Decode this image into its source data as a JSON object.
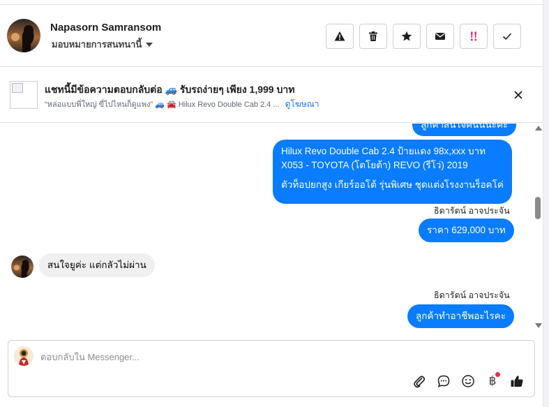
{
  "header": {
    "name": "Napasorn Samransom",
    "assign_label": "มอบหมายการสนทนานี้",
    "actions": [
      {
        "name": "spam-button",
        "icon": "warning-icon"
      },
      {
        "name": "delete-button",
        "icon": "trash-icon"
      },
      {
        "name": "star-button",
        "icon": "star-icon"
      },
      {
        "name": "mark-unread-button",
        "icon": "envelope-icon"
      },
      {
        "name": "follow-up-button",
        "icon": "double-exclamation-icon"
      },
      {
        "name": "done-button",
        "icon": "check-icon"
      }
    ]
  },
  "ad": {
    "title": "แชทนี้มีข้อความตอบกลับต่อ 🚙 รับรถง่ายๆ เพียง 1,999 บาท",
    "subtitle": "“หล่อแบบพี่ใหญ่ ขี่ไปไหนก็ดูแพง” 🚙 🚘 Hilux Revo Double Cab 2.4 ...",
    "view_ad_link": "ดูโฆษณา"
  },
  "messages": {
    "partial_top": "ลูกค้าสนใจคันนี้นะคะ",
    "car_info_line1": "Hilux Revo Double Cab 2.4 ป้ายแดง 98x,xxx บาท",
    "car_info_line2": "X053 - TOYOTA (โตโยต้า) REVO (รีโว่) 2019",
    "car_info_line3": "ตัวท็อปยกสูง เกียร์ออโต้ รุ่นพิเศษ ชุดแต่งโรงงานร็อคโค่",
    "sender_1": "ธิดารัตน์ อาจประจัน",
    "price_msg": "ราคา 629,000 บาท",
    "incoming_msg": "สนใจยูค่ะ แต่กลัวไม่ผ่าน",
    "sender_2": "ธิดารัตน์ อาจประจัน",
    "last_msg": "ลูกค้าทำอาชีพอะไรคะ"
  },
  "composer": {
    "placeholder": "ตอบกลับใน Messenger...",
    "tools": [
      "attachment-icon",
      "saved-reply-icon",
      "emoji-icon",
      "baht-payment-icon",
      "thumbs-up-icon"
    ],
    "baht_symbol": "฿"
  },
  "colors": {
    "accent": "#0a7cff",
    "notification_dot": "#f02849"
  }
}
